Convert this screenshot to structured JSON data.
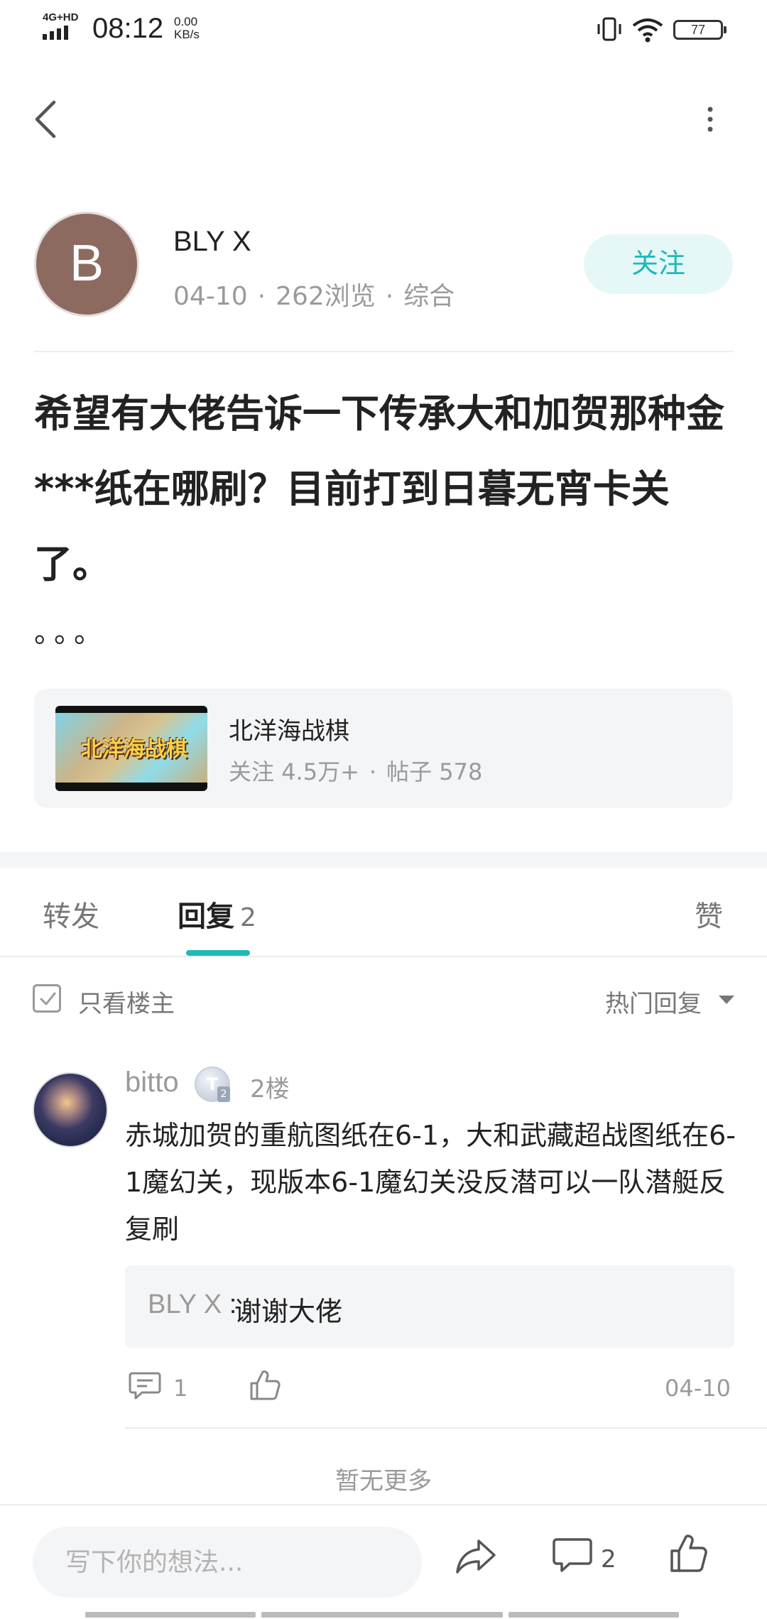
{
  "status_bar": {
    "network": "4G+HD",
    "time": "08:12",
    "speed_value": "0.00",
    "speed_unit": "KB/s",
    "battery": "77"
  },
  "author": {
    "avatar_letter": "B",
    "avatar_color": "#8d6a60",
    "name": "BLY X",
    "date": "04-10",
    "views": "262浏览",
    "category": "综合",
    "follow_label": "关注"
  },
  "post": {
    "title": "希望有大佬告诉一下传承大和加贺那种金***纸在哪刷？目前打到日暮无宵卡关了。",
    "ellipsis": "。。。"
  },
  "game_card": {
    "thumb_logo": "北洋海战棋",
    "name": "北洋海战棋",
    "followers_label": "关注",
    "followers": "4.5万+",
    "posts_label": "帖子",
    "posts": "578"
  },
  "tabs": {
    "forward": "转发",
    "reply": "回复",
    "reply_count": "2",
    "like": "赞"
  },
  "filter": {
    "only_op": "只看楼主",
    "sort": "热门回复"
  },
  "comment": {
    "name": "bitto",
    "badge": "T",
    "badge_level": "2",
    "floor": "2楼",
    "body": "赤城加贺的重航图纸在6-1，大和武藏超战图纸在6-1魔幻关，现版本6-1魔幻关没反潜可以一队潜艇反复刷",
    "subreply_author": "BLY X",
    "subreply_sep": " : ",
    "subreply_text": "谢谢大佬",
    "reply_count": "1",
    "date": "04-10"
  },
  "no_more": "暂无更多",
  "bottom_bar": {
    "input_placeholder": "写下你的想法...",
    "comment_count": "2"
  },
  "colors": {
    "accent": "#1fb8bb",
    "follow_bg": "#e6f7f7",
    "muted_text": "#9a9a9a",
    "card_bg": "#f4f5f7"
  }
}
